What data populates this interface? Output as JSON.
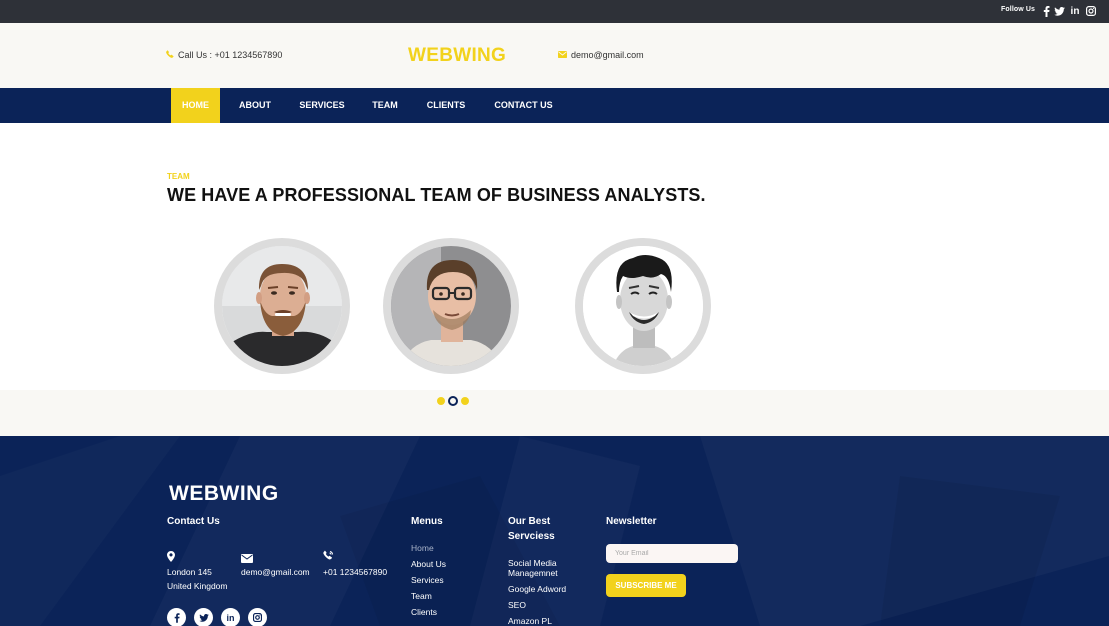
{
  "topbar": {
    "follow_label": "Follow Us",
    "social_icons": [
      "facebook-icon",
      "twitter-icon",
      "linkedin-icon",
      "instagram-icon"
    ]
  },
  "header": {
    "call_text": "Call Us : +01 1234567890",
    "logo": "WEBWING",
    "email": "demo@gmail.com"
  },
  "nav": {
    "items": [
      "HOME",
      "ABOUT",
      "SERVICES",
      "TEAM",
      "CLIENTS",
      "CONTACT US"
    ],
    "active": "HOME"
  },
  "team": {
    "tag": "TEAM",
    "title": "WE HAVE A PROFESSIONAL TEAM OF BUSINESS ANALYSTS.",
    "carousel_active_index": 1,
    "carousel_count": 3
  },
  "footer": {
    "logo": "WEBWING",
    "contact": {
      "heading": "Contact Us",
      "address_line1": "London 145",
      "address_line2": "United Kingdom",
      "email": "demo@gmail.com",
      "phone": "+01 1234567890"
    },
    "menus": {
      "heading": "Menus",
      "items": [
        "Home",
        "About Us",
        "Services",
        "Team",
        "Clients"
      ]
    },
    "services": {
      "heading_line1": "Our Best",
      "heading_line2": "Servciess",
      "items": [
        "Social Media Managemnet",
        "Google Adword",
        "SEO",
        "Amazon PL"
      ]
    },
    "newsletter": {
      "heading": "Newsletter",
      "placeholder": "Your Email",
      "button": "SUBSCRIBE ME"
    }
  },
  "colors": {
    "accent": "#f2d21c",
    "navy": "#0b2358",
    "topbar": "#2e3138",
    "header_bg": "#f9f8f4"
  }
}
